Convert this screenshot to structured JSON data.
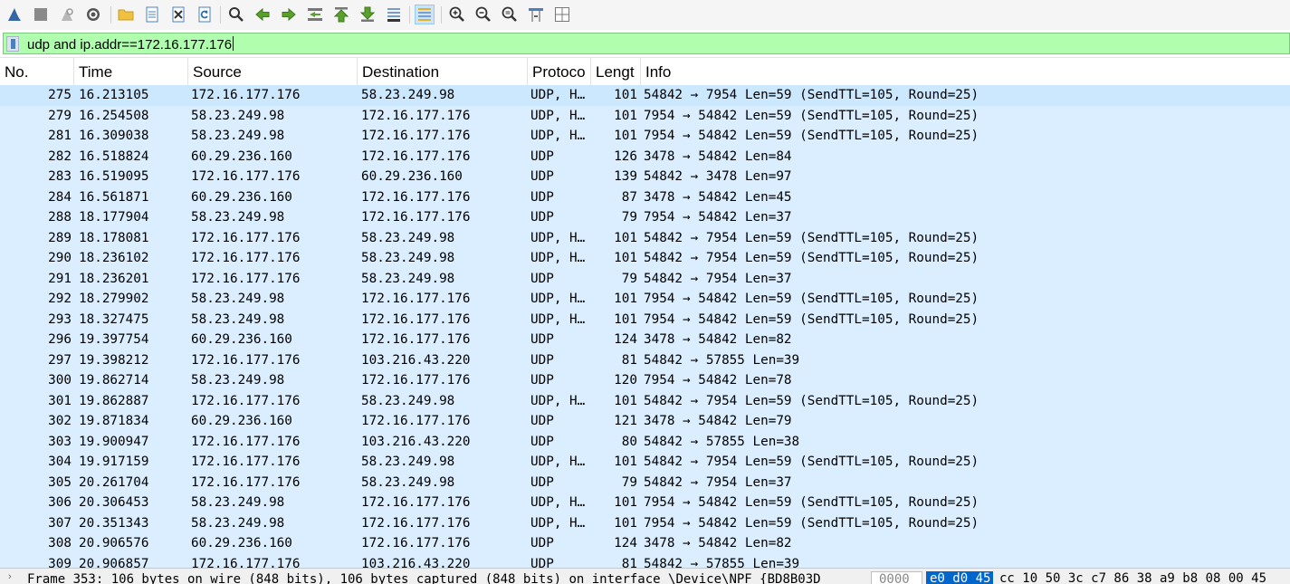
{
  "toolbar": {
    "buttons": [
      {
        "name": "start-capture",
        "icon": "shark-fin-icon"
      },
      {
        "name": "stop-capture",
        "icon": "stop-square-icon"
      },
      {
        "name": "restart-capture",
        "icon": "restart-fin-icon"
      },
      {
        "name": "capture-options",
        "icon": "gear-icon"
      },
      {
        "name": "open-file",
        "icon": "folder-icon"
      },
      {
        "name": "save-file",
        "icon": "document-icon"
      },
      {
        "name": "close-file",
        "icon": "close-file-icon"
      },
      {
        "name": "reload-file",
        "icon": "reload-icon"
      },
      {
        "name": "find-packet",
        "icon": "search-icon"
      },
      {
        "name": "go-back",
        "icon": "arrow-left-icon"
      },
      {
        "name": "go-forward",
        "icon": "arrow-right-icon"
      },
      {
        "name": "go-to-packet",
        "icon": "goto-packet-icon"
      },
      {
        "name": "go-first-packet",
        "icon": "arrow-up-first-icon"
      },
      {
        "name": "go-last-packet",
        "icon": "arrow-down-last-icon"
      },
      {
        "name": "auto-scroll",
        "icon": "autoscroll-icon"
      },
      {
        "name": "colorize",
        "icon": "colorize-lines-icon"
      },
      {
        "name": "zoom-in",
        "icon": "zoom-in-icon"
      },
      {
        "name": "zoom-out",
        "icon": "zoom-out-icon"
      },
      {
        "name": "zoom-normal",
        "icon": "zoom-reset-icon"
      },
      {
        "name": "resize-columns",
        "icon": "resize-columns-icon"
      },
      {
        "name": "layout",
        "icon": "layout-grid-icon"
      }
    ]
  },
  "filter": {
    "value": "udp and ip.addr==172.16.177.176",
    "background": "#afffaf"
  },
  "packet_list": {
    "columns": [
      "No.",
      "Time",
      "Source",
      "Destination",
      "Protoco",
      "Lengt",
      "Info"
    ],
    "selected_row_color": "#cce8ff",
    "row_color": "#daeeff",
    "rows": [
      [
        "275",
        "16.213105",
        "172.16.177.176",
        "58.23.249.98",
        "UDP, H…",
        "101",
        "54842 → 7954 Len=59 (SendTTL=105, Round=25)"
      ],
      [
        "279",
        "16.254508",
        "58.23.249.98",
        "172.16.177.176",
        "UDP, H…",
        "101",
        "7954 → 54842 Len=59 (SendTTL=105, Round=25)"
      ],
      [
        "281",
        "16.309038",
        "58.23.249.98",
        "172.16.177.176",
        "UDP, H…",
        "101",
        "7954 → 54842 Len=59 (SendTTL=105, Round=25)"
      ],
      [
        "282",
        "16.518824",
        "60.29.236.160",
        "172.16.177.176",
        "UDP",
        "126",
        "3478 → 54842 Len=84"
      ],
      [
        "283",
        "16.519095",
        "172.16.177.176",
        "60.29.236.160",
        "UDP",
        "139",
        "54842 → 3478 Len=97"
      ],
      [
        "284",
        "16.561871",
        "60.29.236.160",
        "172.16.177.176",
        "UDP",
        "87",
        "3478 → 54842 Len=45"
      ],
      [
        "288",
        "18.177904",
        "58.23.249.98",
        "172.16.177.176",
        "UDP",
        "79",
        "7954 → 54842 Len=37"
      ],
      [
        "289",
        "18.178081",
        "172.16.177.176",
        "58.23.249.98",
        "UDP, H…",
        "101",
        "54842 → 7954 Len=59 (SendTTL=105, Round=25)"
      ],
      [
        "290",
        "18.236102",
        "172.16.177.176",
        "58.23.249.98",
        "UDP, H…",
        "101",
        "54842 → 7954 Len=59 (SendTTL=105, Round=25)"
      ],
      [
        "291",
        "18.236201",
        "172.16.177.176",
        "58.23.249.98",
        "UDP",
        "79",
        "54842 → 7954 Len=37"
      ],
      [
        "292",
        "18.279902",
        "58.23.249.98",
        "172.16.177.176",
        "UDP, H…",
        "101",
        "7954 → 54842 Len=59 (SendTTL=105, Round=25)"
      ],
      [
        "293",
        "18.327475",
        "58.23.249.98",
        "172.16.177.176",
        "UDP, H…",
        "101",
        "7954 → 54842 Len=59 (SendTTL=105, Round=25)"
      ],
      [
        "296",
        "19.397754",
        "60.29.236.160",
        "172.16.177.176",
        "UDP",
        "124",
        "3478 → 54842 Len=82"
      ],
      [
        "297",
        "19.398212",
        "172.16.177.176",
        "103.216.43.220",
        "UDP",
        "81",
        "54842 → 57855 Len=39"
      ],
      [
        "300",
        "19.862714",
        "58.23.249.98",
        "172.16.177.176",
        "UDP",
        "120",
        "7954 → 54842 Len=78"
      ],
      [
        "301",
        "19.862887",
        "172.16.177.176",
        "58.23.249.98",
        "UDP, H…",
        "101",
        "54842 → 7954 Len=59 (SendTTL=105, Round=25)"
      ],
      [
        "302",
        "19.871834",
        "60.29.236.160",
        "172.16.177.176",
        "UDP",
        "121",
        "3478 → 54842 Len=79"
      ],
      [
        "303",
        "19.900947",
        "172.16.177.176",
        "103.216.43.220",
        "UDP",
        "80",
        "54842 → 57855 Len=38"
      ],
      [
        "304",
        "19.917159",
        "172.16.177.176",
        "58.23.249.98",
        "UDP, H…",
        "101",
        "54842 → 7954 Len=59 (SendTTL=105, Round=25)"
      ],
      [
        "305",
        "20.261704",
        "172.16.177.176",
        "58.23.249.98",
        "UDP",
        "79",
        "54842 → 7954 Len=37"
      ],
      [
        "306",
        "20.306453",
        "58.23.249.98",
        "172.16.177.176",
        "UDP, H…",
        "101",
        "7954 → 54842 Len=59 (SendTTL=105, Round=25)"
      ],
      [
        "307",
        "20.351343",
        "58.23.249.98",
        "172.16.177.176",
        "UDP, H…",
        "101",
        "7954 → 54842 Len=59 (SendTTL=105, Round=25)"
      ],
      [
        "308",
        "20.906576",
        "60.29.236.160",
        "172.16.177.176",
        "UDP",
        "124",
        "3478 → 54842 Len=82"
      ],
      [
        "309",
        "20.906857",
        "172.16.177.176",
        "103.216.43.220",
        "UDP",
        "81",
        "54842 → 57855 Len=39"
      ]
    ]
  },
  "status": {
    "frame_summary": "Frame 353: 106 bytes on wire (848 bits), 106 bytes captured (848 bits) on interface \\Device\\NPF_{BD8B03D",
    "offset": "0000",
    "highlighted_bytes": "e0 d0 45",
    "hex_rest": "cc 10 50 3c c7  86 38 a9 b8 08 00 45"
  }
}
